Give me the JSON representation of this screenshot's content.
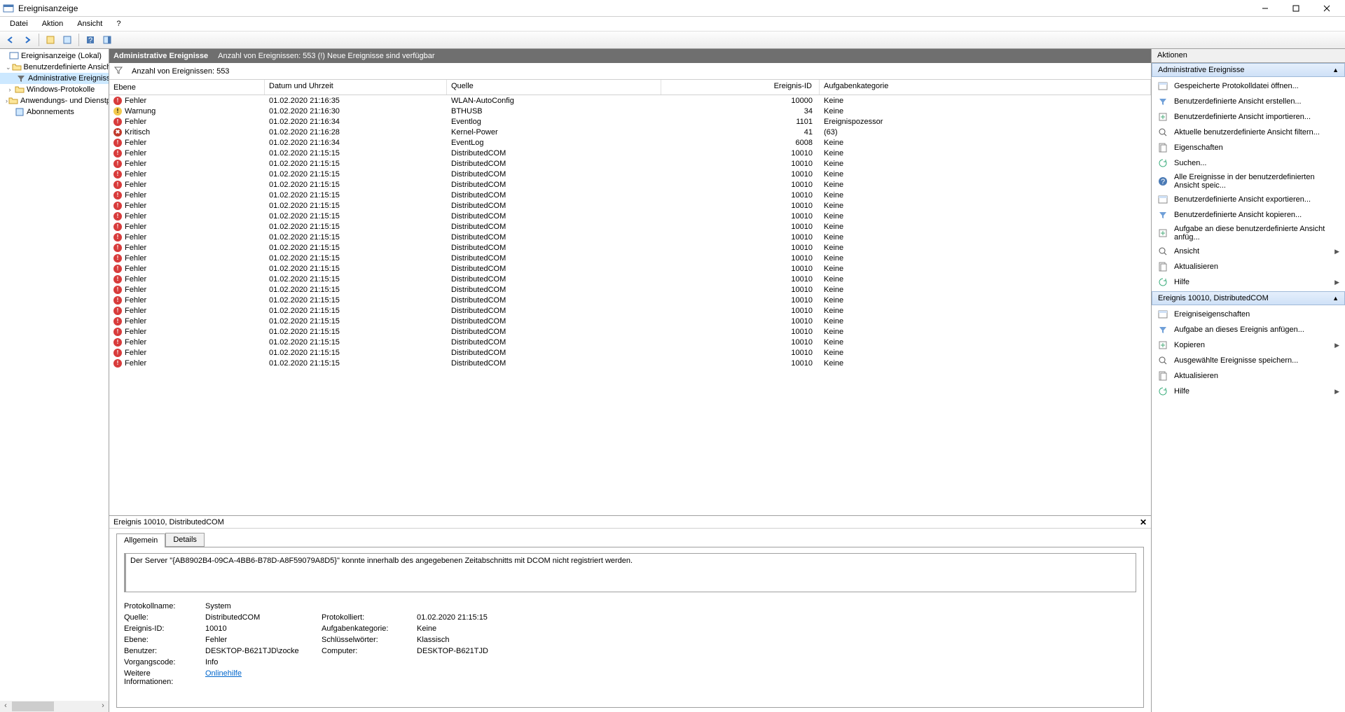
{
  "window": {
    "title": "Ereignisanzeige"
  },
  "menu": {
    "file": "Datei",
    "action": "Aktion",
    "view": "Ansicht",
    "help": "?"
  },
  "tree": {
    "root": "Ereignisanzeige (Lokal)",
    "custom_views": "Benutzerdefinierte Ansichten",
    "admin_events": "Administrative Ereignisse",
    "windows_logs": "Windows-Protokolle",
    "app_service_logs": "Anwendungs- und Dienstpro",
    "subscriptions": "Abonnements"
  },
  "center": {
    "title": "Administrative Ereignisse",
    "subtitle": "Anzahl von Ereignissen: 553 (!) Neue Ereignisse sind verfügbar",
    "filter_count": "Anzahl von Ereignissen: 553",
    "columns": {
      "level": "Ebene",
      "date": "Datum und Uhrzeit",
      "source": "Quelle",
      "id": "Ereignis-ID",
      "category": "Aufgabenkategorie"
    }
  },
  "levels": {
    "error": "Fehler",
    "warning": "Warnung",
    "critical": "Kritisch"
  },
  "events": [
    {
      "lvl": "error",
      "date": "01.02.2020 21:16:35",
      "src": "WLAN-AutoConfig",
      "id": "10000",
      "cat": "Keine"
    },
    {
      "lvl": "warning",
      "date": "01.02.2020 21:16:30",
      "src": "BTHUSB",
      "id": "34",
      "cat": "Keine"
    },
    {
      "lvl": "error",
      "date": "01.02.2020 21:16:34",
      "src": "Eventlog",
      "id": "1101",
      "cat": "Ereignispozessor"
    },
    {
      "lvl": "critical",
      "date": "01.02.2020 21:16:28",
      "src": "Kernel-Power",
      "id": "41",
      "cat": "(63)"
    },
    {
      "lvl": "error",
      "date": "01.02.2020 21:16:34",
      "src": "EventLog",
      "id": "6008",
      "cat": "Keine"
    },
    {
      "lvl": "error",
      "date": "01.02.2020 21:15:15",
      "src": "DistributedCOM",
      "id": "10010",
      "cat": "Keine"
    },
    {
      "lvl": "error",
      "date": "01.02.2020 21:15:15",
      "src": "DistributedCOM",
      "id": "10010",
      "cat": "Keine"
    },
    {
      "lvl": "error",
      "date": "01.02.2020 21:15:15",
      "src": "DistributedCOM",
      "id": "10010",
      "cat": "Keine"
    },
    {
      "lvl": "error",
      "date": "01.02.2020 21:15:15",
      "src": "DistributedCOM",
      "id": "10010",
      "cat": "Keine"
    },
    {
      "lvl": "error",
      "date": "01.02.2020 21:15:15",
      "src": "DistributedCOM",
      "id": "10010",
      "cat": "Keine"
    },
    {
      "lvl": "error",
      "date": "01.02.2020 21:15:15",
      "src": "DistributedCOM",
      "id": "10010",
      "cat": "Keine"
    },
    {
      "lvl": "error",
      "date": "01.02.2020 21:15:15",
      "src": "DistributedCOM",
      "id": "10010",
      "cat": "Keine"
    },
    {
      "lvl": "error",
      "date": "01.02.2020 21:15:15",
      "src": "DistributedCOM",
      "id": "10010",
      "cat": "Keine"
    },
    {
      "lvl": "error",
      "date": "01.02.2020 21:15:15",
      "src": "DistributedCOM",
      "id": "10010",
      "cat": "Keine"
    },
    {
      "lvl": "error",
      "date": "01.02.2020 21:15:15",
      "src": "DistributedCOM",
      "id": "10010",
      "cat": "Keine"
    },
    {
      "lvl": "error",
      "date": "01.02.2020 21:15:15",
      "src": "DistributedCOM",
      "id": "10010",
      "cat": "Keine"
    },
    {
      "lvl": "error",
      "date": "01.02.2020 21:15:15",
      "src": "DistributedCOM",
      "id": "10010",
      "cat": "Keine"
    },
    {
      "lvl": "error",
      "date": "01.02.2020 21:15:15",
      "src": "DistributedCOM",
      "id": "10010",
      "cat": "Keine"
    },
    {
      "lvl": "error",
      "date": "01.02.2020 21:15:15",
      "src": "DistributedCOM",
      "id": "10010",
      "cat": "Keine"
    },
    {
      "lvl": "error",
      "date": "01.02.2020 21:15:15",
      "src": "DistributedCOM",
      "id": "10010",
      "cat": "Keine"
    },
    {
      "lvl": "error",
      "date": "01.02.2020 21:15:15",
      "src": "DistributedCOM",
      "id": "10010",
      "cat": "Keine"
    },
    {
      "lvl": "error",
      "date": "01.02.2020 21:15:15",
      "src": "DistributedCOM",
      "id": "10010",
      "cat": "Keine"
    },
    {
      "lvl": "error",
      "date": "01.02.2020 21:15:15",
      "src": "DistributedCOM",
      "id": "10010",
      "cat": "Keine"
    },
    {
      "lvl": "error",
      "date": "01.02.2020 21:15:15",
      "src": "DistributedCOM",
      "id": "10010",
      "cat": "Keine"
    },
    {
      "lvl": "error",
      "date": "01.02.2020 21:15:15",
      "src": "DistributedCOM",
      "id": "10010",
      "cat": "Keine"
    },
    {
      "lvl": "error",
      "date": "01.02.2020 21:15:15",
      "src": "DistributedCOM",
      "id": "10010",
      "cat": "Keine"
    }
  ],
  "detail": {
    "title": "Ereignis 10010, DistributedCOM",
    "tabs": {
      "general": "Allgemein",
      "details": "Details"
    },
    "description": "Der Server \"{AB8902B4-09CA-4BB6-B78D-A8F59079A8D5}\" konnte innerhalb des angegebenen Zeitabschnitts mit DCOM nicht registriert werden.",
    "labels": {
      "logname": "Protokollname:",
      "source": "Quelle:",
      "logged": "Protokolliert:",
      "eventid": "Ereignis-ID:",
      "category": "Aufgabenkategorie:",
      "level": "Ebene:",
      "keywords": "Schlüsselwörter:",
      "user": "Benutzer:",
      "computer": "Computer:",
      "opcode": "Vorgangscode:",
      "moreinfo": "Weitere Informationen:"
    },
    "values": {
      "logname": "System",
      "source": "DistributedCOM",
      "logged": "01.02.2020 21:15:15",
      "eventid": "10010",
      "category": "Keine",
      "level": "Fehler",
      "keywords": "Klassisch",
      "user": "DESKTOP-B621TJD\\zocke",
      "computer": "DESKTOP-B621TJD",
      "opcode": "Info",
      "onlinehelp": "Onlinehilfe"
    }
  },
  "actions": {
    "panel_title": "Aktionen",
    "section1": "Administrative Ereignisse",
    "section2": "Ereignis 10010, DistributedCOM",
    "group1": [
      "Gespeicherte Protokolldatei öffnen...",
      "Benutzerdefinierte Ansicht erstellen...",
      "Benutzerdefinierte Ansicht importieren...",
      "Aktuelle benutzerdefinierte Ansicht filtern...",
      "Eigenschaften",
      "Suchen...",
      "Alle Ereignisse in der benutzerdefinierten Ansicht speic...",
      "Benutzerdefinierte Ansicht exportieren...",
      "Benutzerdefinierte Ansicht kopieren...",
      "Aufgabe an diese benutzerdefinierte Ansicht anfüg...",
      "Ansicht",
      "Aktualisieren",
      "Hilfe"
    ],
    "group2": [
      "Ereigniseigenschaften",
      "Aufgabe an dieses Ereignis anfügen...",
      "Kopieren",
      "Ausgewählte Ereignisse speichern...",
      "Aktualisieren",
      "Hilfe"
    ],
    "submenu_indices1": [
      10,
      12
    ],
    "submenu_indices2": [
      2,
      5
    ]
  }
}
